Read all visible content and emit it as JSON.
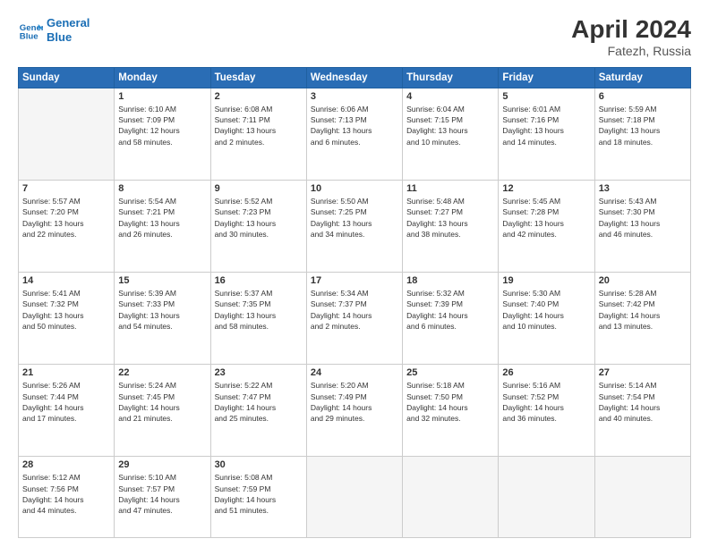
{
  "header": {
    "logo_line1": "General",
    "logo_line2": "Blue",
    "month": "April 2024",
    "location": "Fatezh, Russia"
  },
  "weekdays": [
    "Sunday",
    "Monday",
    "Tuesday",
    "Wednesday",
    "Thursday",
    "Friday",
    "Saturday"
  ],
  "weeks": [
    [
      {
        "day": "",
        "info": ""
      },
      {
        "day": "1",
        "info": "Sunrise: 6:10 AM\nSunset: 7:09 PM\nDaylight: 12 hours\nand 58 minutes."
      },
      {
        "day": "2",
        "info": "Sunrise: 6:08 AM\nSunset: 7:11 PM\nDaylight: 13 hours\nand 2 minutes."
      },
      {
        "day": "3",
        "info": "Sunrise: 6:06 AM\nSunset: 7:13 PM\nDaylight: 13 hours\nand 6 minutes."
      },
      {
        "day": "4",
        "info": "Sunrise: 6:04 AM\nSunset: 7:15 PM\nDaylight: 13 hours\nand 10 minutes."
      },
      {
        "day": "5",
        "info": "Sunrise: 6:01 AM\nSunset: 7:16 PM\nDaylight: 13 hours\nand 14 minutes."
      },
      {
        "day": "6",
        "info": "Sunrise: 5:59 AM\nSunset: 7:18 PM\nDaylight: 13 hours\nand 18 minutes."
      }
    ],
    [
      {
        "day": "7",
        "info": "Sunrise: 5:57 AM\nSunset: 7:20 PM\nDaylight: 13 hours\nand 22 minutes."
      },
      {
        "day": "8",
        "info": "Sunrise: 5:54 AM\nSunset: 7:21 PM\nDaylight: 13 hours\nand 26 minutes."
      },
      {
        "day": "9",
        "info": "Sunrise: 5:52 AM\nSunset: 7:23 PM\nDaylight: 13 hours\nand 30 minutes."
      },
      {
        "day": "10",
        "info": "Sunrise: 5:50 AM\nSunset: 7:25 PM\nDaylight: 13 hours\nand 34 minutes."
      },
      {
        "day": "11",
        "info": "Sunrise: 5:48 AM\nSunset: 7:27 PM\nDaylight: 13 hours\nand 38 minutes."
      },
      {
        "day": "12",
        "info": "Sunrise: 5:45 AM\nSunset: 7:28 PM\nDaylight: 13 hours\nand 42 minutes."
      },
      {
        "day": "13",
        "info": "Sunrise: 5:43 AM\nSunset: 7:30 PM\nDaylight: 13 hours\nand 46 minutes."
      }
    ],
    [
      {
        "day": "14",
        "info": "Sunrise: 5:41 AM\nSunset: 7:32 PM\nDaylight: 13 hours\nand 50 minutes."
      },
      {
        "day": "15",
        "info": "Sunrise: 5:39 AM\nSunset: 7:33 PM\nDaylight: 13 hours\nand 54 minutes."
      },
      {
        "day": "16",
        "info": "Sunrise: 5:37 AM\nSunset: 7:35 PM\nDaylight: 13 hours\nand 58 minutes."
      },
      {
        "day": "17",
        "info": "Sunrise: 5:34 AM\nSunset: 7:37 PM\nDaylight: 14 hours\nand 2 minutes."
      },
      {
        "day": "18",
        "info": "Sunrise: 5:32 AM\nSunset: 7:39 PM\nDaylight: 14 hours\nand 6 minutes."
      },
      {
        "day": "19",
        "info": "Sunrise: 5:30 AM\nSunset: 7:40 PM\nDaylight: 14 hours\nand 10 minutes."
      },
      {
        "day": "20",
        "info": "Sunrise: 5:28 AM\nSunset: 7:42 PM\nDaylight: 14 hours\nand 13 minutes."
      }
    ],
    [
      {
        "day": "21",
        "info": "Sunrise: 5:26 AM\nSunset: 7:44 PM\nDaylight: 14 hours\nand 17 minutes."
      },
      {
        "day": "22",
        "info": "Sunrise: 5:24 AM\nSunset: 7:45 PM\nDaylight: 14 hours\nand 21 minutes."
      },
      {
        "day": "23",
        "info": "Sunrise: 5:22 AM\nSunset: 7:47 PM\nDaylight: 14 hours\nand 25 minutes."
      },
      {
        "day": "24",
        "info": "Sunrise: 5:20 AM\nSunset: 7:49 PM\nDaylight: 14 hours\nand 29 minutes."
      },
      {
        "day": "25",
        "info": "Sunrise: 5:18 AM\nSunset: 7:50 PM\nDaylight: 14 hours\nand 32 minutes."
      },
      {
        "day": "26",
        "info": "Sunrise: 5:16 AM\nSunset: 7:52 PM\nDaylight: 14 hours\nand 36 minutes."
      },
      {
        "day": "27",
        "info": "Sunrise: 5:14 AM\nSunset: 7:54 PM\nDaylight: 14 hours\nand 40 minutes."
      }
    ],
    [
      {
        "day": "28",
        "info": "Sunrise: 5:12 AM\nSunset: 7:56 PM\nDaylight: 14 hours\nand 44 minutes."
      },
      {
        "day": "29",
        "info": "Sunrise: 5:10 AM\nSunset: 7:57 PM\nDaylight: 14 hours\nand 47 minutes."
      },
      {
        "day": "30",
        "info": "Sunrise: 5:08 AM\nSunset: 7:59 PM\nDaylight: 14 hours\nand 51 minutes."
      },
      {
        "day": "",
        "info": ""
      },
      {
        "day": "",
        "info": ""
      },
      {
        "day": "",
        "info": ""
      },
      {
        "day": "",
        "info": ""
      }
    ]
  ]
}
